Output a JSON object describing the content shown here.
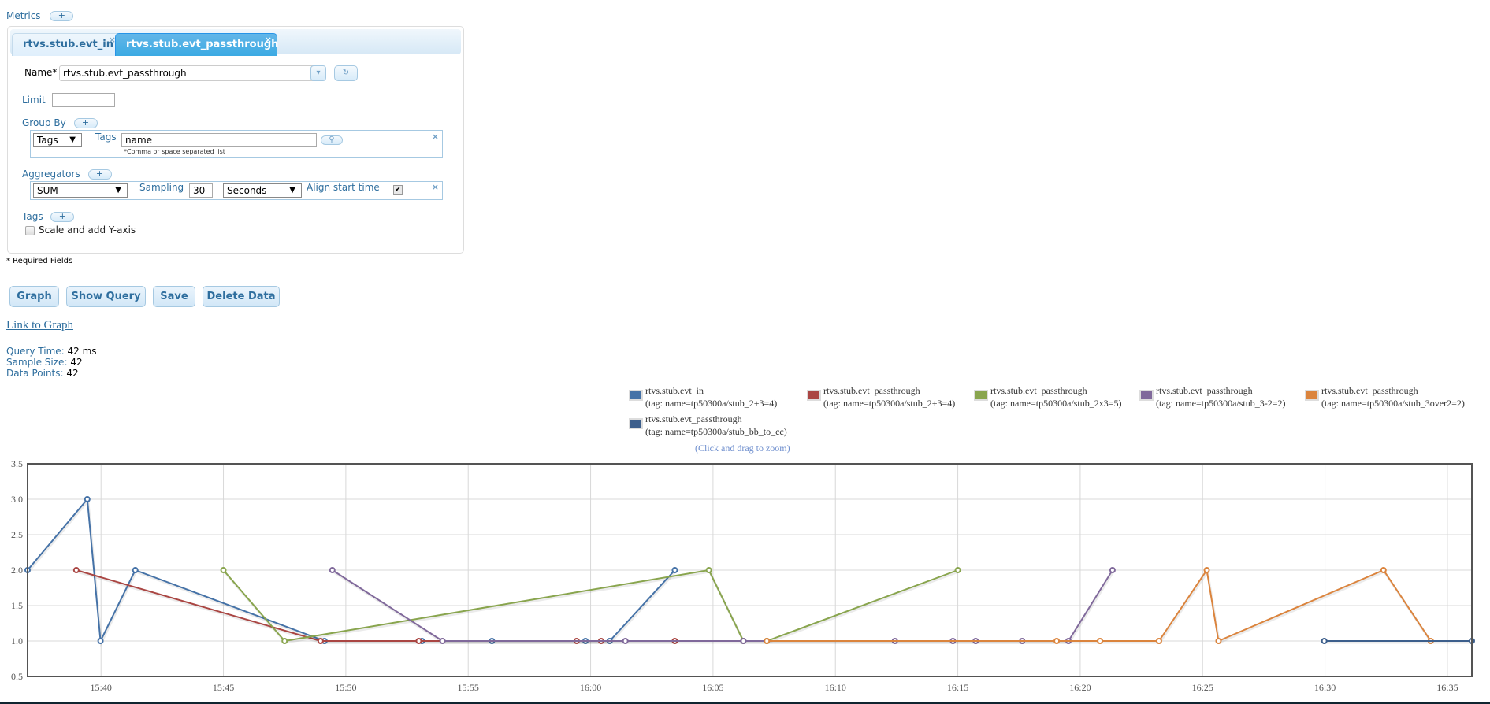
{
  "metrics_header": {
    "label": "Metrics",
    "add_label": "+"
  },
  "tabs": [
    {
      "label": "rtvs.stub.evt_in",
      "close": "×",
      "active": false
    },
    {
      "label": "rtvs.stub.evt_passthrough",
      "close": "×",
      "active": true
    }
  ],
  "form": {
    "name_label": "Name*",
    "name_value": "rtvs.stub.evt_passthrough",
    "name_dropdown_icon": "caret-down-icon",
    "refresh_icon": "refresh-icon",
    "limit_label": "Limit",
    "limit_value": "",
    "group_by_label": "Group By",
    "group_by_add": "+",
    "group_by_type": "Tags",
    "group_by_tags_label": "Tags",
    "group_by_tags_value": "name",
    "group_by_hint": "*Comma or space separated list",
    "group_by_search_icon": "search-icon",
    "remove_icon": "×",
    "aggregators_label": "Aggregators",
    "aggregators_add": "+",
    "aggregator_value": "SUM",
    "sampling_label": "Sampling",
    "sampling_value": "30",
    "sampling_unit": "Seconds",
    "align_label": "Align start time",
    "align_checked": true,
    "tags_label": "Tags",
    "tags_add": "+",
    "scale_label": "Scale and add Y-axis",
    "scale_checked": false
  },
  "required_note": "* Required Fields",
  "buttons": {
    "graph": "Graph",
    "show_query": "Show Query",
    "save": "Save",
    "delete": "Delete Data"
  },
  "link_to_graph": "Link to Graph",
  "stats": {
    "query_time_label": "Query Time:",
    "query_time_value": "42 ms",
    "sample_size_label": "Sample Size:",
    "sample_size_value": "42",
    "data_points_label": "Data Points:",
    "data_points_value": "42"
  },
  "zoom_hint": "(Click and drag to zoom)",
  "chart_data": {
    "type": "line",
    "title": "",
    "xlabel": "",
    "ylabel": "",
    "x_unit": "minutes since 15:37",
    "xlim": [
      0,
      59
    ],
    "ylim": [
      0.5,
      3.5
    ],
    "yticks": [
      "0.5",
      "1.0",
      "1.5",
      "2.0",
      "2.5",
      "3.0",
      "3.5"
    ],
    "xticks": [
      {
        "label": "15:40",
        "t": 3
      },
      {
        "label": "15:45",
        "t": 8
      },
      {
        "label": "15:50",
        "t": 13
      },
      {
        "label": "15:55",
        "t": 18
      },
      {
        "label": "16:00",
        "t": 23
      },
      {
        "label": "16:05",
        "t": 28
      },
      {
        "label": "16:10",
        "t": 33
      },
      {
        "label": "16:15",
        "t": 38
      },
      {
        "label": "16:20",
        "t": 43
      },
      {
        "label": "16:25",
        "t": 48
      },
      {
        "label": "16:30",
        "t": 53
      },
      {
        "label": "16:35",
        "t": 58
      }
    ],
    "grid": true,
    "legend_position": "top-right",
    "series": [
      {
        "name": "rtvs.stub.evt_in",
        "tag": "(tag: name=tp50300a/stub_2+3=4)",
        "color": "#4572a7",
        "t": [
          0,
          2.44,
          2.98,
          4.4,
          12.13,
          16.11,
          18.97,
          22.79,
          23.78,
          26.44
        ],
        "values": [
          2,
          3,
          1,
          2,
          1,
          1,
          1,
          1,
          1,
          2
        ]
      },
      {
        "name": "rtvs.stub.evt_passthrough",
        "tag": "(tag: name=tp50300a/stub_2+3=4)",
        "color": "#aa4643",
        "t": [
          1.99,
          11.97,
          15.98,
          22.43,
          23.43,
          26.44
        ],
        "values": [
          2,
          1,
          1,
          1,
          1,
          1
        ]
      },
      {
        "name": "rtvs.stub.evt_passthrough",
        "tag": "(tag: name=tp50300a/stub_2x3=5)",
        "color": "#89a54e",
        "t": [
          8.0,
          10.5,
          27.83,
          29.24,
          30.2,
          38.0
        ],
        "values": [
          2,
          1,
          2,
          1,
          1,
          2
        ]
      },
      {
        "name": "rtvs.stub.evt_passthrough",
        "tag": "(tag: name=tp50300a/stub_3-2=2)",
        "color": "#80699b",
        "t": [
          12.45,
          16.95,
          24.42,
          29.24,
          35.43,
          37.8,
          38.73,
          40.63,
          42.52,
          44.32
        ],
        "values": [
          2,
          1,
          1,
          1,
          1,
          1,
          1,
          1,
          1,
          2
        ]
      },
      {
        "name": "rtvs.stub.evt_passthrough",
        "tag": "(tag: name=tp50300a/stub_3over2=2)",
        "color": "#db843d",
        "t": [
          30.2,
          42.04,
          43.81,
          46.22,
          48.17,
          48.65,
          55.39,
          57.32
        ],
        "values": [
          1,
          1,
          1,
          1,
          2,
          1,
          2,
          1
        ]
      },
      {
        "name": "rtvs.stub.evt_passthrough",
        "tag": "(tag: name=tp50300a/stub_bb_to_cc)",
        "color": "#3d5f8c",
        "t": [
          52.97,
          59.0
        ],
        "values": [
          1,
          1
        ]
      }
    ]
  }
}
